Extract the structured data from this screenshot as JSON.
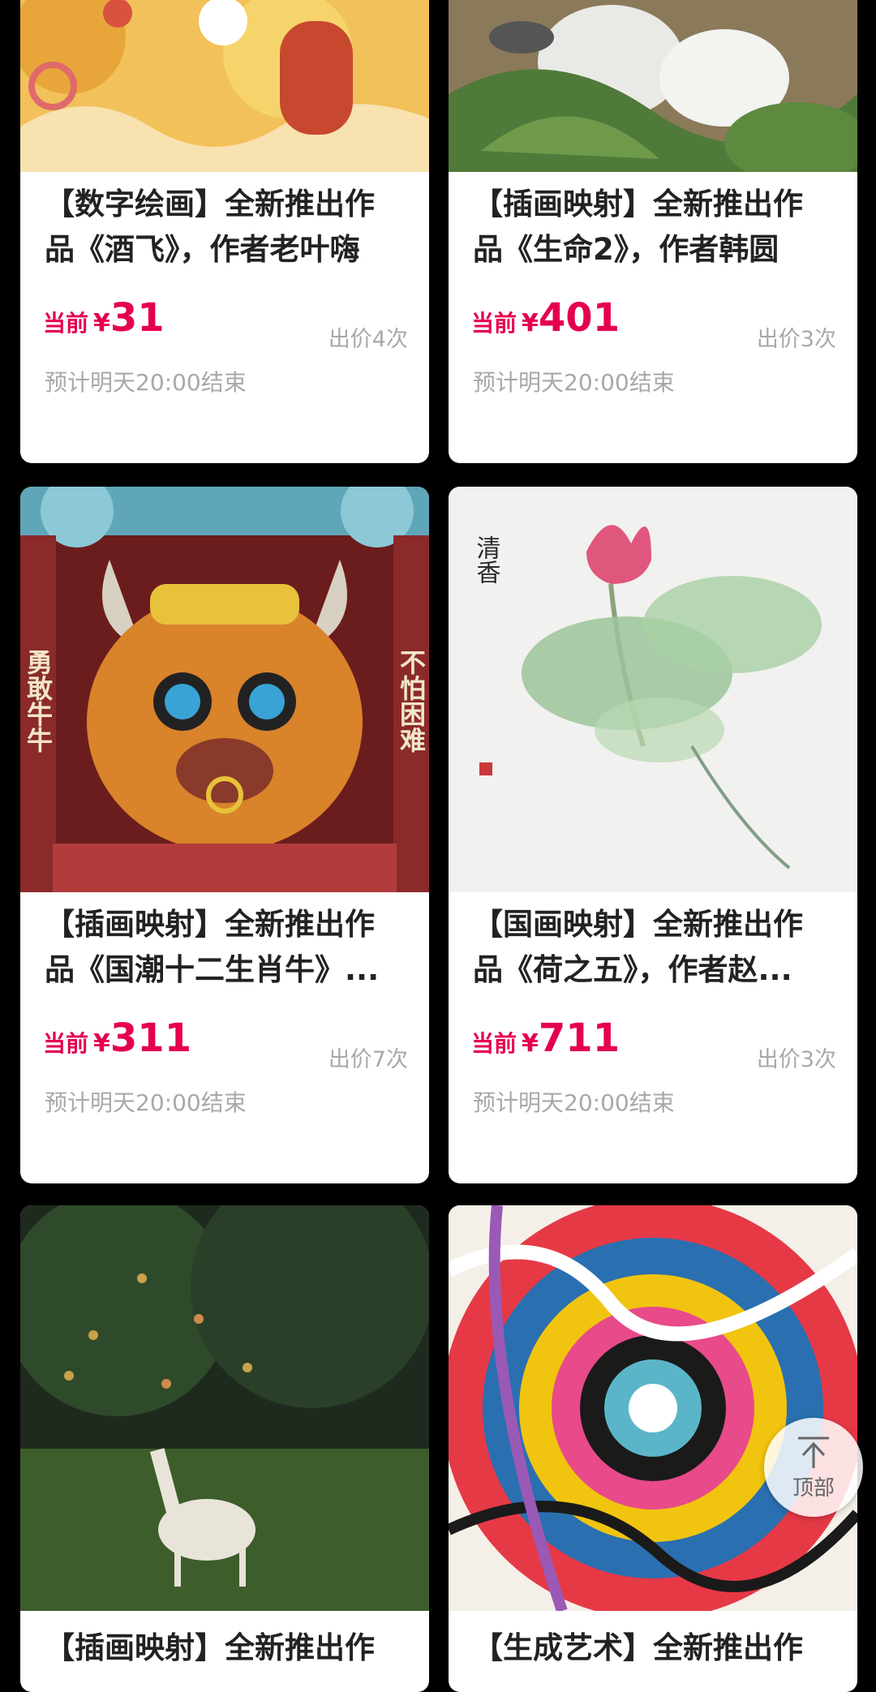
{
  "cards": [
    {
      "title_1": "【数字绘画】全新推出作",
      "title_2": "品《酒飞》，作者老叶嗨",
      "price_label": "当前",
      "currency": "¥",
      "price": "31",
      "bids": "出价4次",
      "end_time": "预计明天20:00结束"
    },
    {
      "title_1": "【插画映射】全新推出作",
      "title_2": "品《生命2》，作者韩圆",
      "price_label": "当前",
      "currency": "¥",
      "price": "401",
      "bids": "出价3次",
      "end_time": "预计明天20:00结束"
    },
    {
      "title_1": "【插画映射】全新推出作",
      "title_2": "品《国潮十二生肖牛》...",
      "price_label": "当前",
      "currency": "¥",
      "price": "311",
      "bids": "出价7次",
      "end_time": "预计明天20:00结束",
      "art_text_left": "勇敢牛牛",
      "art_text_right": "不怕困难"
    },
    {
      "title_1": "【国画映射】全新推出作",
      "title_2": "品《荷之五》，作者赵...",
      "price_label": "当前",
      "currency": "¥",
      "price": "711",
      "bids": "出价3次",
      "end_time": "预计明天20:00结束",
      "art_text": "清香"
    },
    {
      "title_1": "【插画映射】全新推出作"
    },
    {
      "title_1": "【生成艺术】全新推出作"
    }
  ],
  "back_to_top": {
    "label": "顶部",
    "icon": "arrow-up-bar-icon"
  },
  "colors": {
    "price": "#e5004f",
    "muted": "#a8a8a8",
    "background": "#000000"
  }
}
